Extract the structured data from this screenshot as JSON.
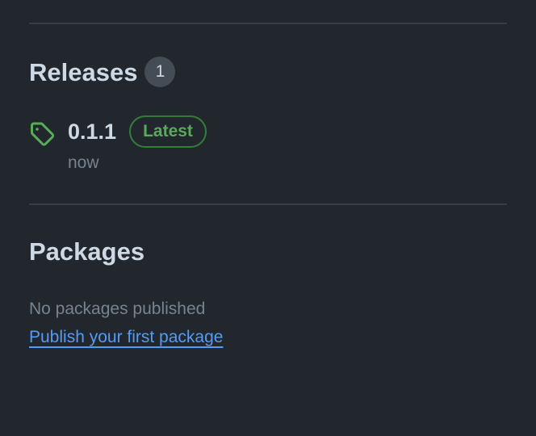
{
  "releases": {
    "title": "Releases",
    "count": "1",
    "items": [
      {
        "version": "0.1.1",
        "badge": "Latest",
        "time": "now",
        "icon": "tag-icon"
      }
    ]
  },
  "packages": {
    "title": "Packages",
    "empty_text": "No packages published",
    "link_text": "Publish your first package"
  },
  "colors": {
    "background": "#22272e",
    "heading": "#cdd9e5",
    "muted": "#768390",
    "success": "#57ab5a",
    "link": "#539bf5",
    "divider": "#373e47"
  }
}
